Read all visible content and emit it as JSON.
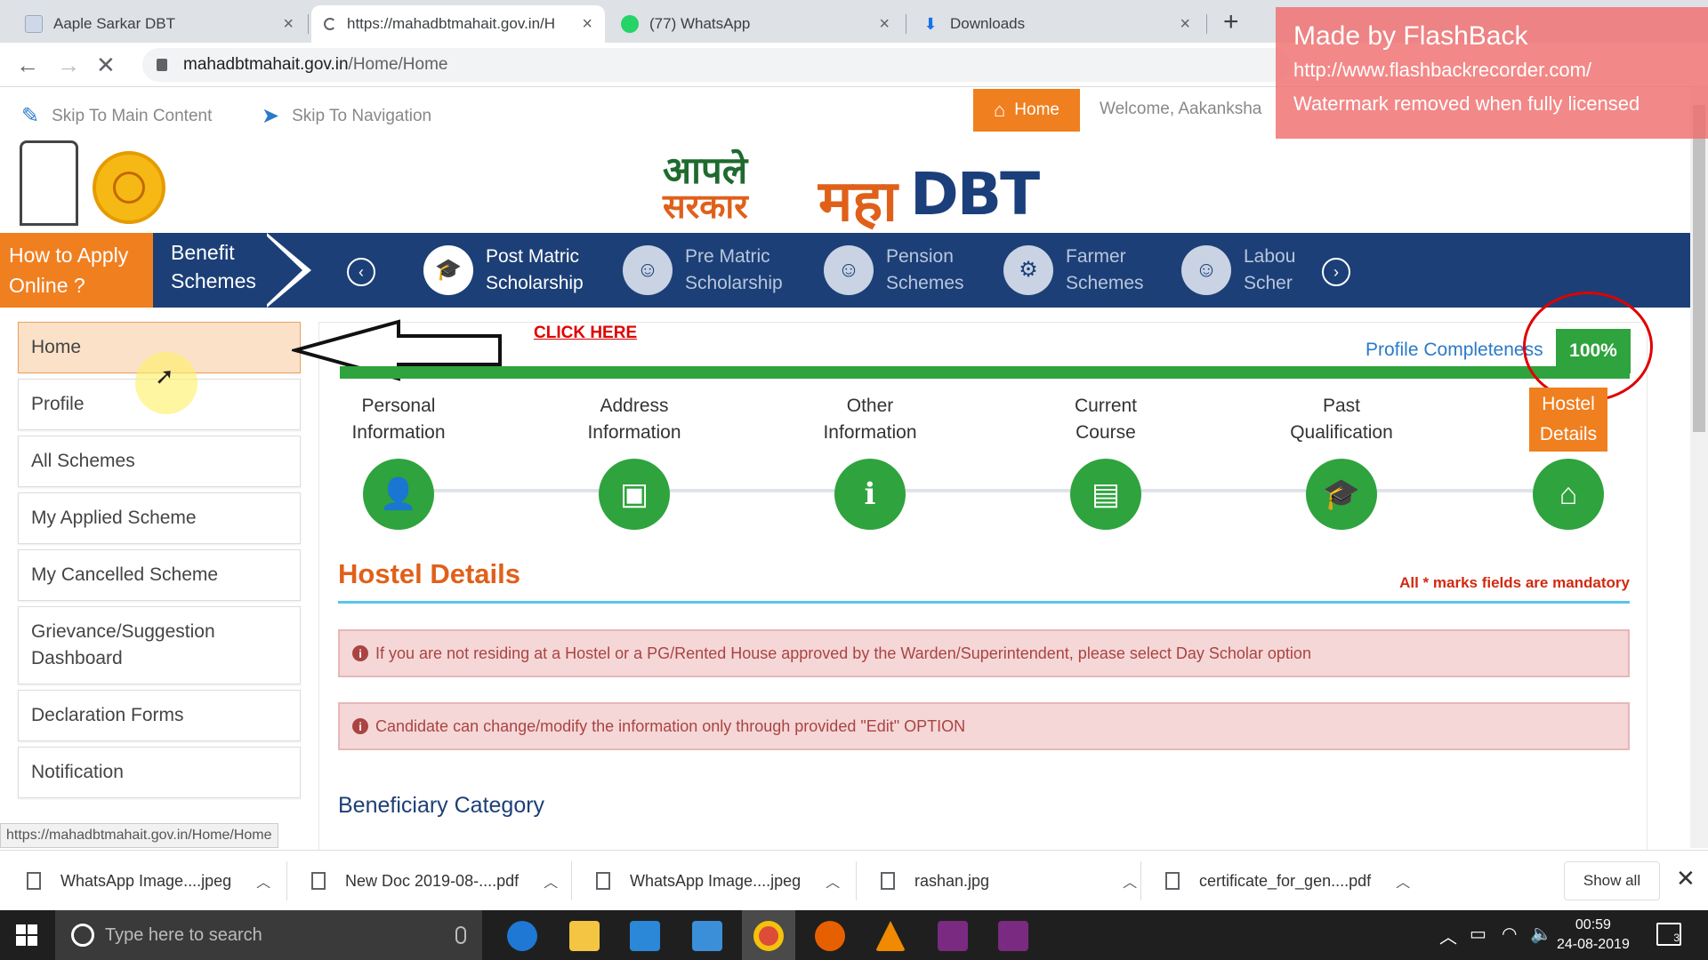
{
  "browser": {
    "tabs": [
      {
        "title": "Aaple Sarkar DBT",
        "active": false
      },
      {
        "title": "https://mahadbtmahait.gov.in/H",
        "active": true
      },
      {
        "title": "(77) WhatsApp",
        "active": false
      },
      {
        "title": "Downloads",
        "active": false
      }
    ],
    "url_host": "mahadbtmahait.gov.in",
    "url_path": "/Home/Home"
  },
  "watermark": {
    "line1": "Made by FlashBack",
    "line2": "http://www.flashbackrecorder.com/",
    "line3": "Watermark removed when fully licensed"
  },
  "topbar": {
    "skip_main": "Skip To Main Content",
    "skip_nav": "Skip To Navigation",
    "home": "Home",
    "welcome": "Welcome, Aakanksha"
  },
  "logo": {
    "aaple": "आपले",
    "sarkar": "सरकार",
    "maha": "महा",
    "dbt": "DBT"
  },
  "schemes_nav": {
    "how_to": "How to Apply Online ?",
    "benefit": "Benefit Schemes",
    "items": [
      {
        "line1": "Post Matric",
        "line2": "Scholarship"
      },
      {
        "line1": "Pre Matric",
        "line2": "Scholarship"
      },
      {
        "line1": "Pension",
        "line2": "Schemes"
      },
      {
        "line1": "Farmer",
        "line2": "Schemes"
      },
      {
        "line1": "Labou",
        "line2": "Scher"
      }
    ]
  },
  "menu": [
    "Home",
    "Profile",
    "All Schemes",
    "My Applied Scheme",
    "My Cancelled Scheme",
    "Grievance/Suggestion Dashboard",
    "Declaration Forms",
    "Notification"
  ],
  "annotation": {
    "click_here": "CLICK HERE"
  },
  "profile": {
    "label": "Profile Completeness",
    "percent_text": "100%",
    "completeness": 1.0
  },
  "steps": [
    {
      "line1": "Personal",
      "line2": "Information",
      "icon": "user-icon"
    },
    {
      "line1": "Address",
      "line2": "Information",
      "icon": "address-card-icon"
    },
    {
      "line1": "Other",
      "line2": "Information",
      "icon": "info-icon"
    },
    {
      "line1": "Current",
      "line2": "Course",
      "icon": "book-icon"
    },
    {
      "line1": "Past",
      "line2": "Qualification",
      "icon": "graduation-cap-icon"
    },
    {
      "line1": "Hostel",
      "line2": "Details",
      "icon": "home-icon"
    }
  ],
  "section": {
    "title": "Hostel Details",
    "mandatory": "All * marks fields are mandatory",
    "alert1": "If you are not residing at a Hostel or a PG/Rented House approved by the Warden/Superintendent, please select Day Scholar option",
    "alert2": "Candidate can change/modify the information only through provided \"Edit\" OPTION",
    "beneficiary": "Beneficiary Category"
  },
  "status_url": "https://mahadbtmahait.gov.in/Home/Home",
  "downloads": [
    "WhatsApp Image....jpeg",
    "New Doc 2019-08-....pdf",
    "WhatsApp Image....jpeg",
    "rashan.jpg",
    "certificate_for_gen....pdf"
  ],
  "show_all": "Show all",
  "taskbar": {
    "search_placeholder": "Type here to search",
    "time": "00:59",
    "date": "24-08-2019",
    "notifications": "3"
  },
  "colors": {
    "accent_orange": "#f07f20",
    "navy": "#1c3f77",
    "green": "#2fa33d"
  }
}
